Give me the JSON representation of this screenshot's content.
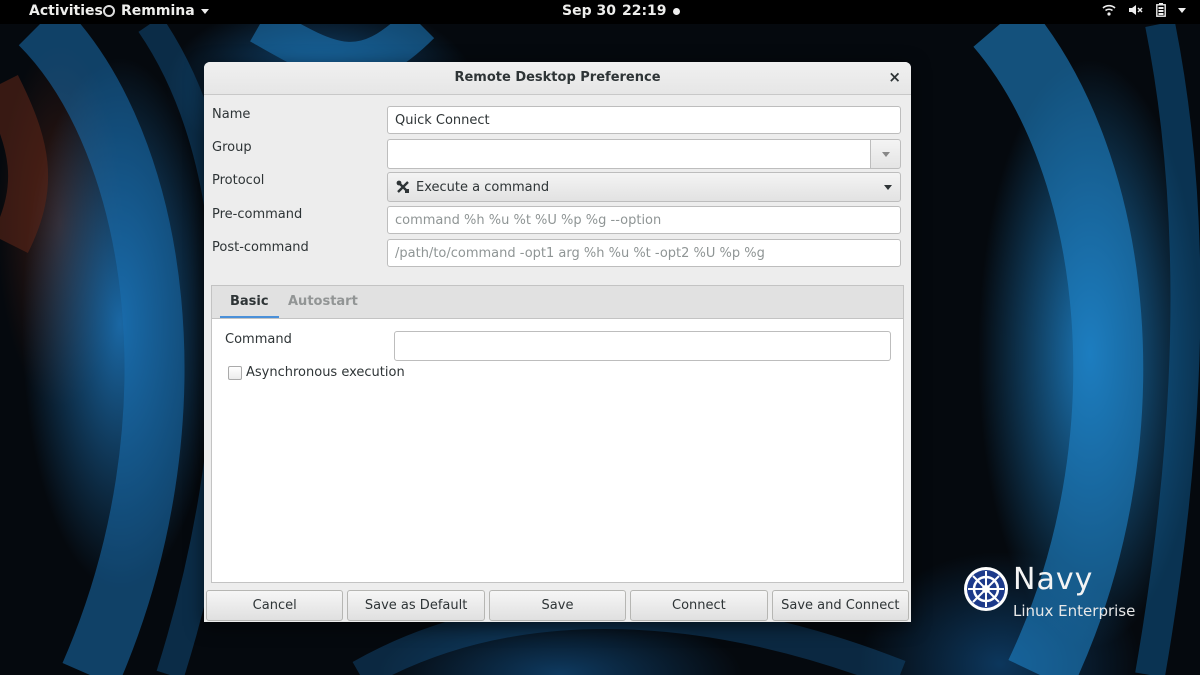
{
  "topbar": {
    "activities": "Activities",
    "app_name": "Remmina",
    "date": "Sep 30",
    "time": "22:19",
    "tray_icons": [
      "wifi-icon",
      "volume-muted-icon",
      "battery-icon",
      "system-menu-caret-icon"
    ]
  },
  "dialog": {
    "title": "Remote Desktop Preference",
    "close_label": "×",
    "name_label": "Name",
    "name_value": "Quick Connect",
    "group_label": "Group",
    "group_value": "",
    "protocol_label": "Protocol",
    "protocol_value": "Execute a command",
    "precommand_label": "Pre-command",
    "precommand_placeholder": "command %h %u %t %U %p %g --option",
    "postcommand_label": "Post-command",
    "postcommand_placeholder": "/path/to/command -opt1 arg %h %u %t -opt2 %U %p %g",
    "tabs": [
      {
        "label": "Basic",
        "active": true
      },
      {
        "label": "Autostart",
        "active": false
      }
    ],
    "basic": {
      "command_label": "Command",
      "command_value": "",
      "async_label": "Asynchronous execution",
      "async_checked": false
    },
    "buttons": {
      "cancel": "Cancel",
      "save_default": "Save as Default",
      "save": "Save",
      "connect": "Connect",
      "save_connect": "Save and Connect"
    }
  },
  "branding": {
    "name": "Navy",
    "subtitle": "Linux Enterprise"
  },
  "colors": {
    "accent": "#4a90d9",
    "dialog_bg": "#ededed",
    "topbar_bg": "#000000"
  }
}
